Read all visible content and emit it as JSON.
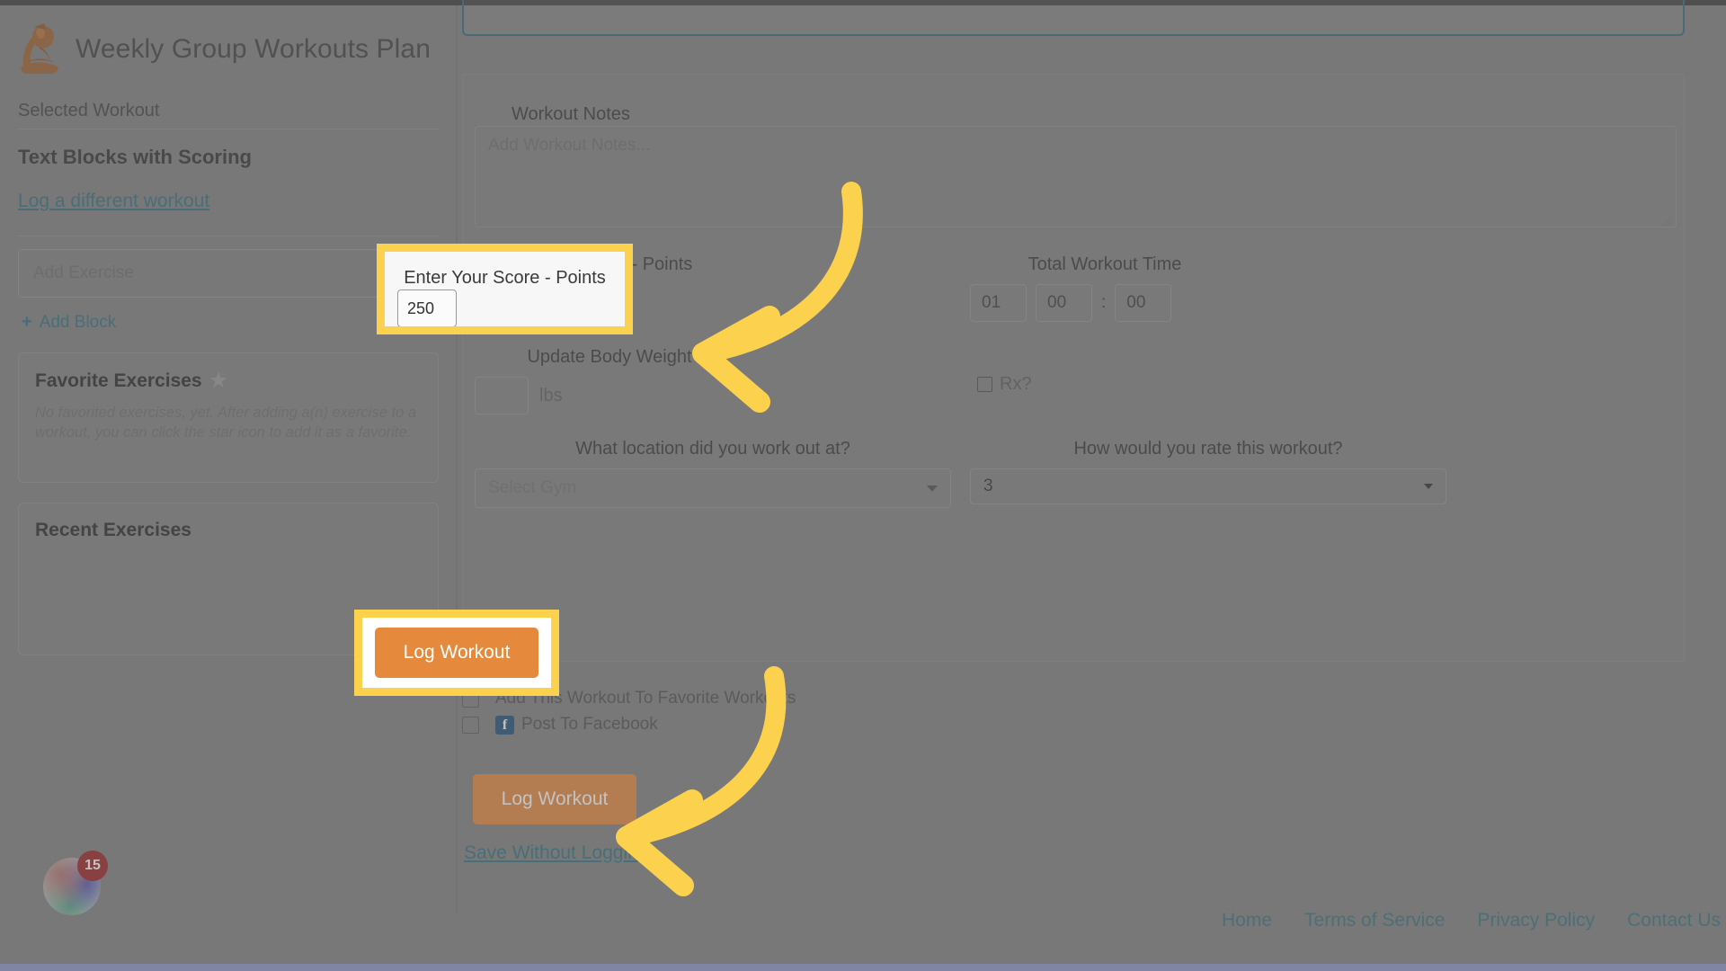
{
  "theme": {
    "highlight": "#FBD14E",
    "arrow": "#FBD14E",
    "primary_button": "#E5893D",
    "link": "#2E6E7E",
    "teal_border": "#2B6B7A",
    "badge_red": "#9C1F1F",
    "facebook_blue": "#1F4E79"
  },
  "sidebar": {
    "logo_icon": "thinker-statue-logo",
    "title": "Weekly Group Workouts Plan",
    "selected_workout_label": "Selected Workout",
    "workout_name": "Text Blocks with Scoring",
    "log_different_link": "Log a different workout",
    "search": {
      "placeholder": "Add Exercise",
      "icon": "search-icon"
    },
    "add_block_label": "Add Block",
    "add_block_icon": "plus-icon",
    "favorites": {
      "title": "Favorite Exercises",
      "star_icon": "star-icon",
      "empty_text": "No favorited exercises, yet. After adding a(n) exercise to a workout, you can click the star icon to add it as a favorite."
    },
    "recent": {
      "title": "Recent Exercises"
    },
    "chat_widget": {
      "icon": "chat-bubble-icon",
      "badge_count": "15"
    }
  },
  "main": {
    "notes": {
      "label": "Workout Notes",
      "placeholder": "Add Workout Notes...",
      "value": ""
    },
    "score": {
      "label": "Enter Your Score - Points",
      "value": "250"
    },
    "total_time": {
      "label": "Total Workout Time",
      "hours": "01",
      "minutes": "00",
      "seconds": "00",
      "separator": ":"
    },
    "body_weight": {
      "label": "Update Body Weight",
      "value": "",
      "unit": "lbs"
    },
    "rx": {
      "label": "Rx?",
      "checked": false
    },
    "location": {
      "label": "What location did you work out at?",
      "placeholder": "Select Gym",
      "value": "",
      "caret_icon": "chevron-down-icon"
    },
    "rating": {
      "label": "How would you rate this workout?",
      "value": "3",
      "caret_icon": "chevron-down-icon"
    },
    "checkboxes": [
      {
        "label": "Add This Workout To Favorite Workouts",
        "checked": false,
        "icon": ""
      },
      {
        "label": "Post To Facebook",
        "checked": false,
        "icon": "facebook-icon"
      }
    ],
    "log_button": "Log Workout",
    "save_link": "Save Without Logging"
  },
  "footer": {
    "links": [
      "Home",
      "Terms of Service",
      "Privacy Policy",
      "Contact Us"
    ]
  },
  "annotations": {
    "arrow_top": "curved-arrow-pointing-left-to-score-field",
    "arrow_bottom": "curved-arrow-pointing-left-to-log-workout-button",
    "highlight_score": "highlight-box-score-field",
    "highlight_log": "highlight-box-log-workout-button"
  }
}
